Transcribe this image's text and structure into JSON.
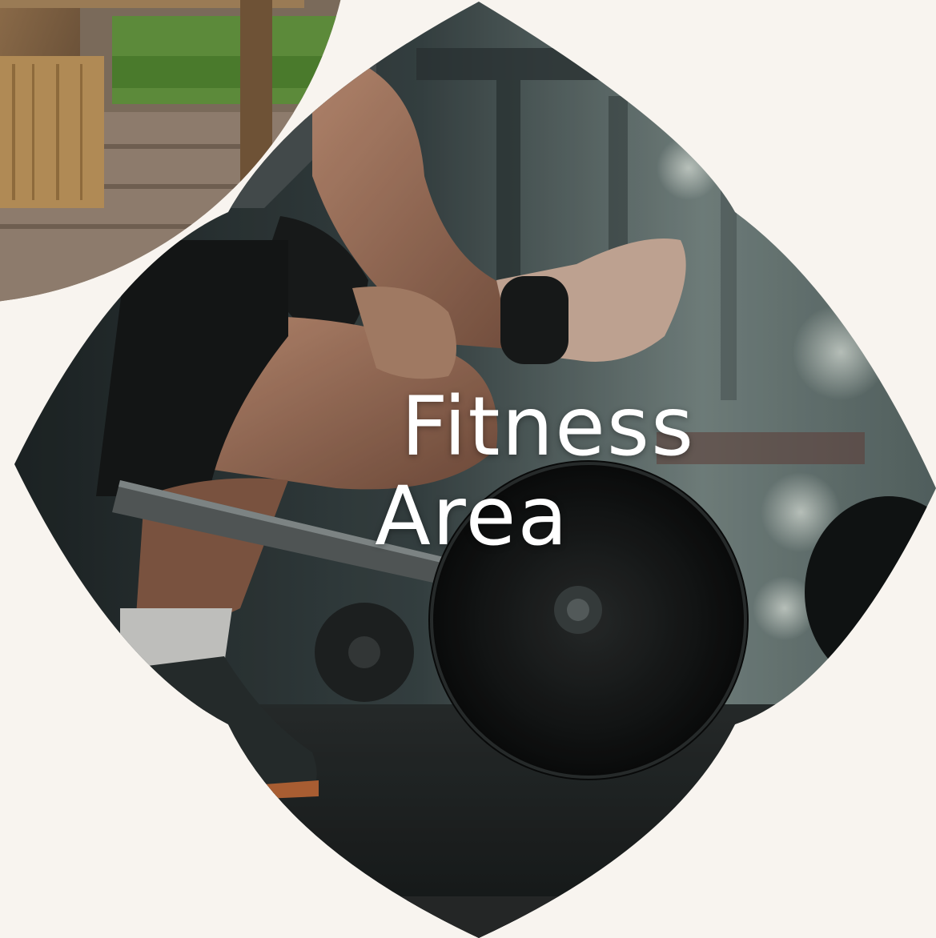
{
  "tile": {
    "title_line1": "Fitness",
    "title_line2": "Area",
    "image_subject": "weightlifting-photo",
    "neighbor_image_subject": "garden-bench-photo"
  },
  "colors": {
    "page_background": "#f8f4ef",
    "title_text": "#ffffff"
  }
}
